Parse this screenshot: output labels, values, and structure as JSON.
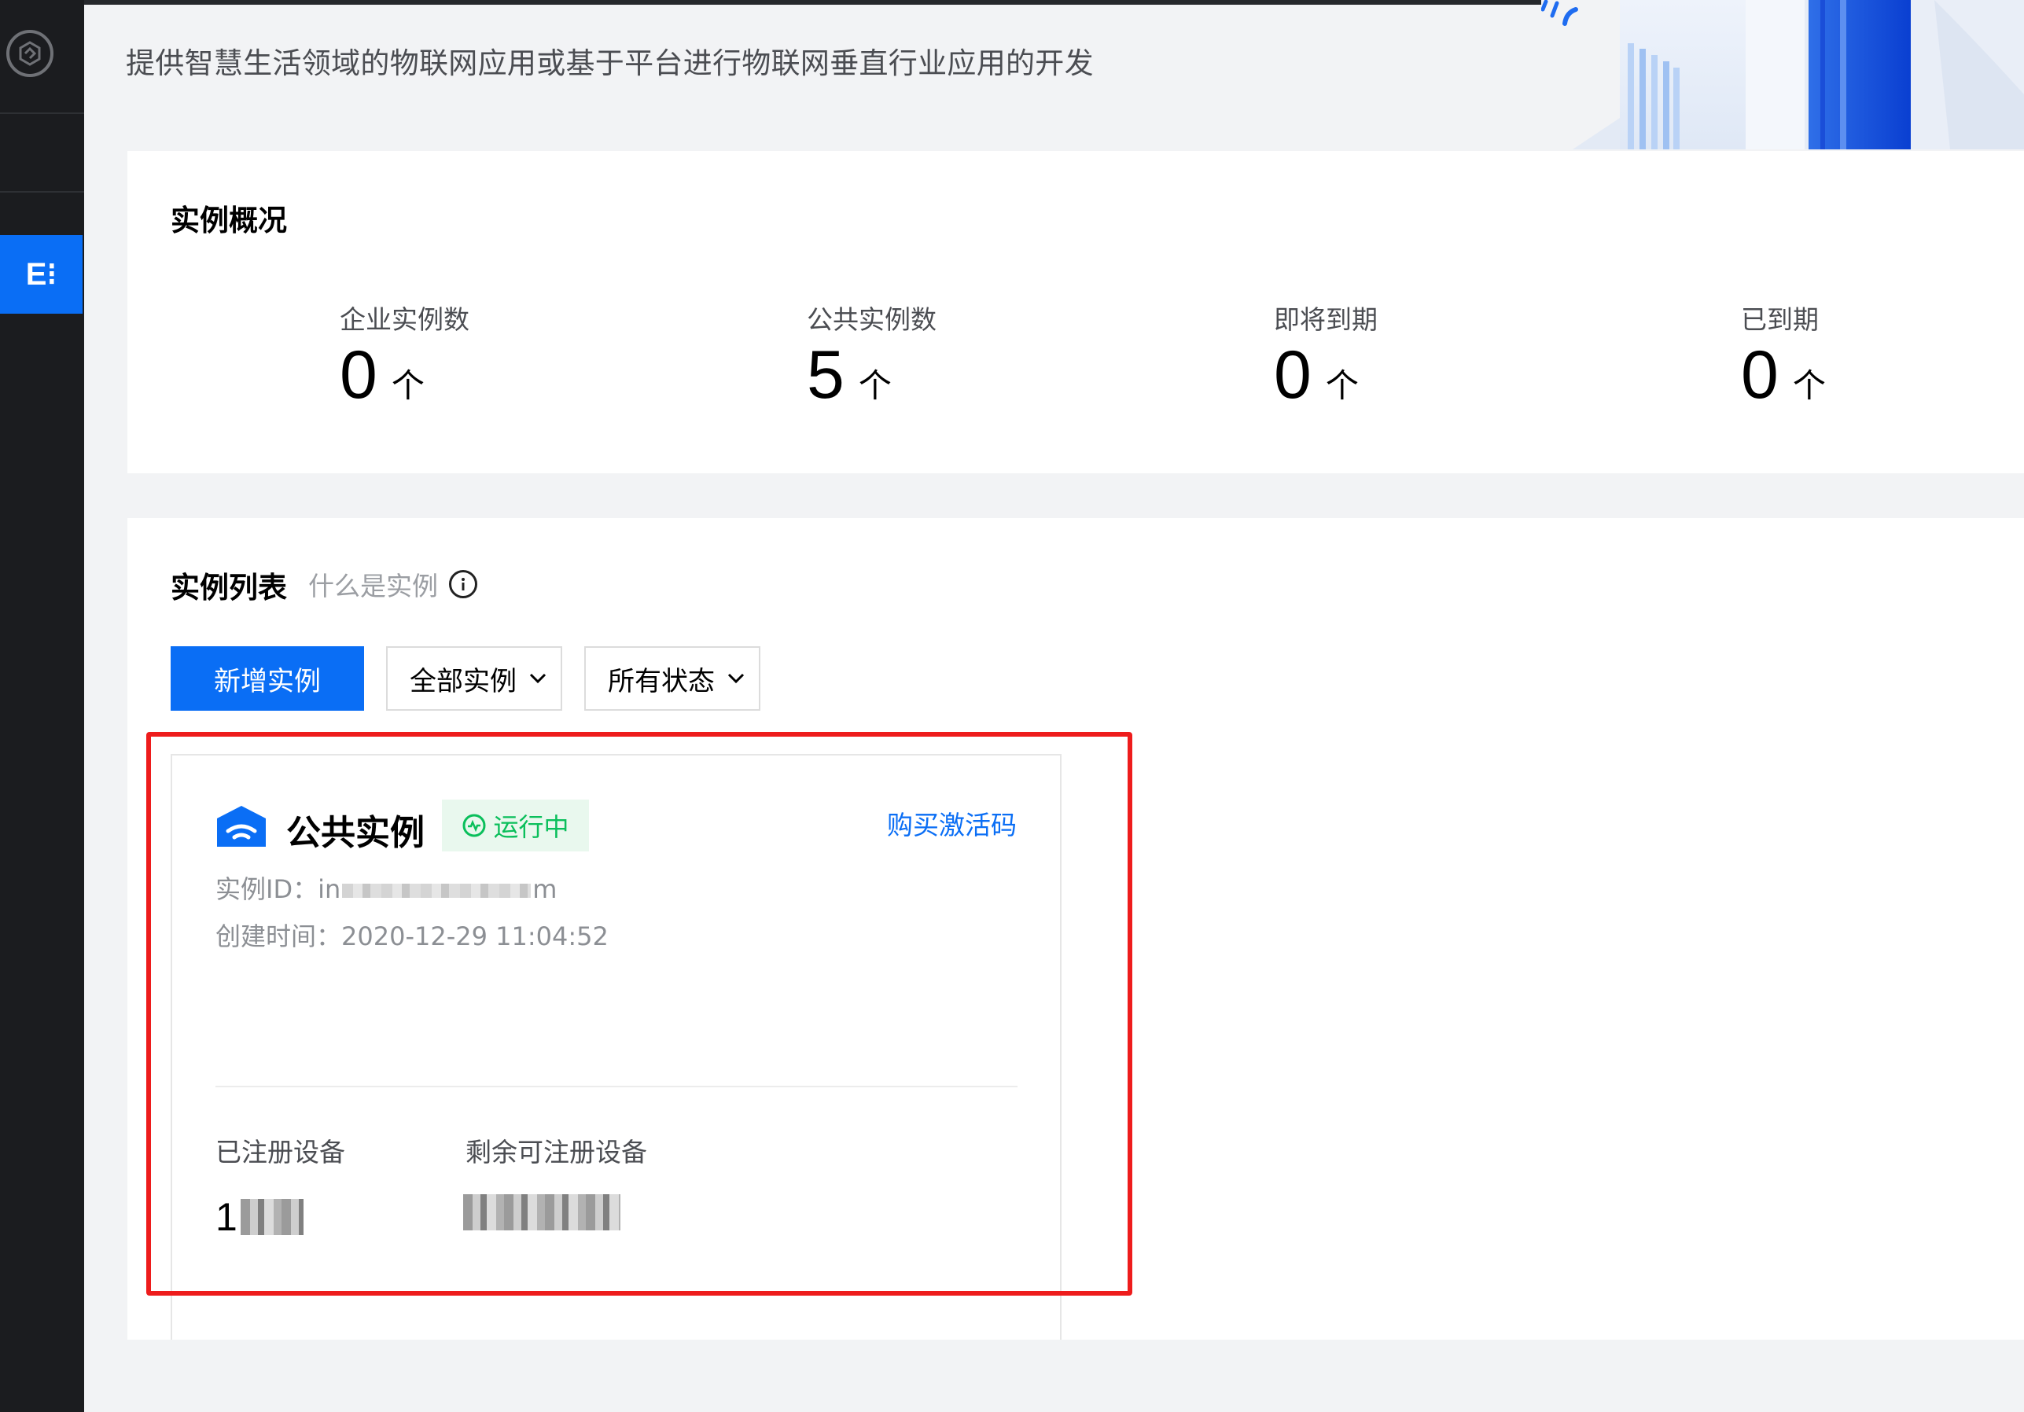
{
  "header": {
    "description": "提供智慧生活领域的物联网应用或基于平台进行物联网垂直行业应用的开发"
  },
  "sidebar": {
    "active_item_label": "E⁝"
  },
  "overview": {
    "title": "实例概况",
    "stats": [
      {
        "label": "企业实例数",
        "value": "0",
        "unit": "个"
      },
      {
        "label": "公共实例数",
        "value": "5",
        "unit": "个"
      },
      {
        "label": "即将到期",
        "value": "0",
        "unit": "个"
      },
      {
        "label": "已到期",
        "value": "0",
        "unit": "个"
      }
    ]
  },
  "instance_list": {
    "title": "实例列表",
    "hint": "什么是实例",
    "add_button": "新增实例",
    "filter_type": "全部实例",
    "filter_status": "所有状态",
    "instance": {
      "name": "公共实例",
      "status": "运行中",
      "buy_link": "购买激活码",
      "id_label": "实例ID：",
      "id_prefix": "in",
      "id_suffix": "m",
      "created_label": "创建时间：",
      "created_value": "2020-12-29 11:04:52",
      "registered_label": "已注册设备",
      "registered_value_visible": "1",
      "remaining_label": "剩余可注册设备"
    }
  },
  "colors": {
    "accent": "#0a6ef5",
    "sidebar_bg": "#1b1c1f",
    "status_green": "#0abf5b",
    "highlight_red": "#ee1c1c"
  }
}
